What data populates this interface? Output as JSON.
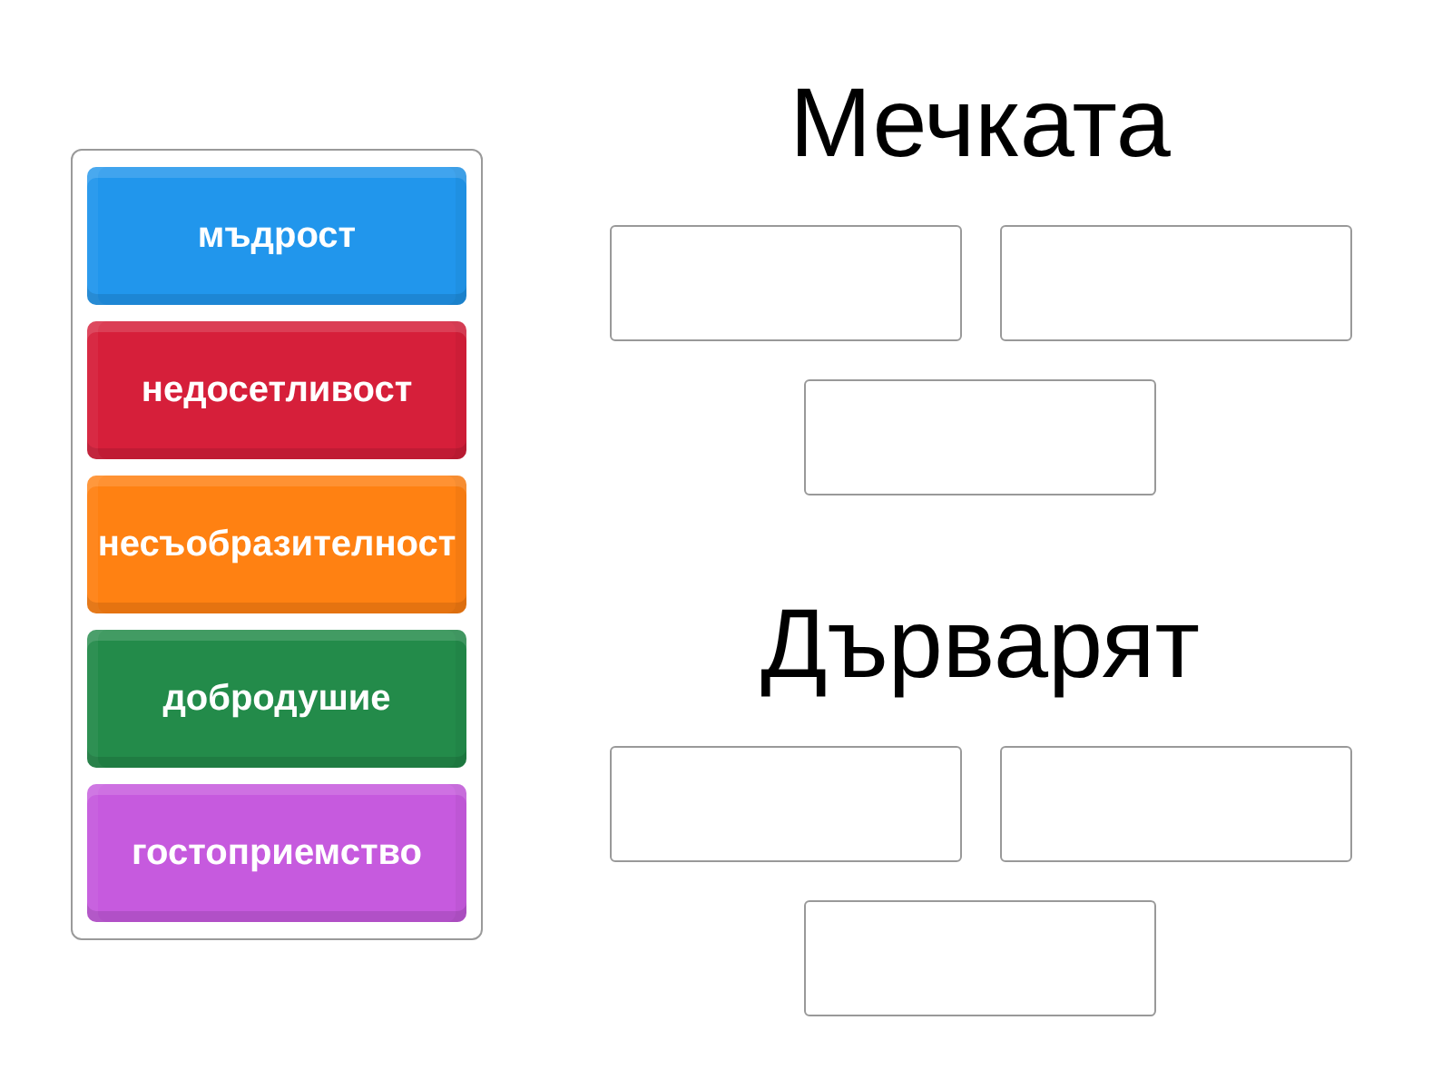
{
  "tiles": [
    {
      "text": "мъдрост",
      "color": "#2196ec"
    },
    {
      "text": "недосетливост",
      "color": "#d61f3a"
    },
    {
      "text": "несъобразителност",
      "color": "#ff8112"
    },
    {
      "text": "добродушие",
      "color": "#238b4a"
    },
    {
      "text": "гостоприемство",
      "color": "#c65ade"
    }
  ],
  "groups": [
    {
      "title": "Мечката",
      "answer_boxes": [
        {
          "kind": "blank"
        },
        {
          "kind": "blank"
        },
        {
          "kind": "blank"
        }
      ]
    },
    {
      "title": "Дърварят",
      "answer_boxes": [
        {
          "kind": "blank"
        },
        {
          "kind": "blank"
        },
        {
          "kind": "blank"
        }
      ]
    }
  ]
}
